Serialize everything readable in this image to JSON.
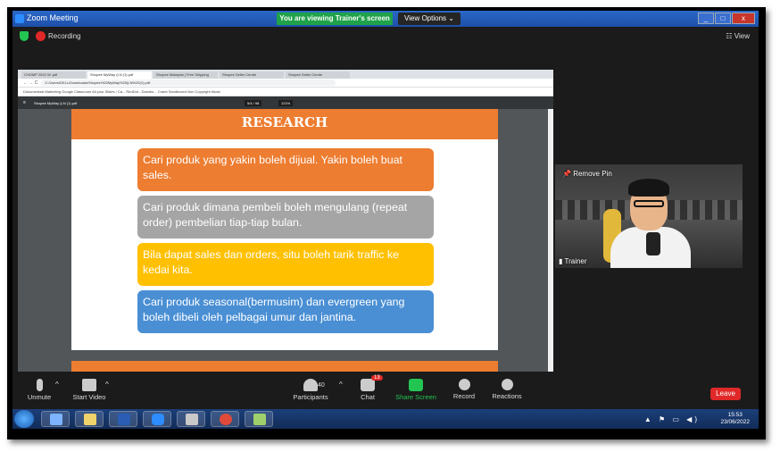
{
  "window": {
    "title": "Zoom Meeting",
    "viewing_badge": "You are viewing Trainer's screen",
    "view_options": "View Options ⌄"
  },
  "top_bar": {
    "recording": "Recording",
    "view": "View"
  },
  "browser": {
    "tabs": [
      "CHOMP 2022 W..pdf",
      "Shopee MyWay (LN (1).pdf",
      "Shopee Malaysia | Free Shipping",
      "Shopee Seller Centre",
      "Shopee Seller Centre"
    ],
    "url": "C:/Users/DELL/Downloads/Shopee%20MyWay%20(LN%20(1).pdf",
    "bookmarks": "Dokumentasi   Marketing   Google Classroom   All your Slides / Ca...   RedDot - Dashbo...   Cramt Sandboxed   Non Copyright Music",
    "pdf_name": "Shopee MyWay (LN (1).pdf",
    "page_indicator": "5/4 / 98",
    "zoom_level": "121%"
  },
  "slide": {
    "title": "RESEARCH",
    "cards": [
      "Cari produk yang yakin boleh dijual. Yakin boleh buat sales.",
      "Cari produk dimana pembeli boleh mengulang (repeat order) pembelian tiap-tiap bulan.",
      "Bila dapat sales dan orders, situ boleh tarik traffic ke kedai kita.",
      "Cari produk seasonal(bermusim) dan evergreen yang boleh dibeli oleh pelbagai umur dan jantina."
    ]
  },
  "video": {
    "remove_pin": "Remove Pin",
    "name": "Trainer"
  },
  "controls": {
    "unmute": "Unmute",
    "start_video": "Start Video",
    "participants": "Participants",
    "participants_count": "40",
    "chat": "Chat",
    "chat_badge": "13",
    "share_screen": "Share Screen",
    "record": "Record",
    "reactions": "Reactions",
    "leave": "Leave"
  },
  "taskbar": {
    "time": "15:53",
    "date": "23/06/2022"
  },
  "colors": {
    "orange": "#ed7d31",
    "gray": "#a5a5a5",
    "yellow": "#ffc000",
    "blue": "#4a8fd4",
    "share_green": "#23c552",
    "leave_red": "#e02828"
  }
}
